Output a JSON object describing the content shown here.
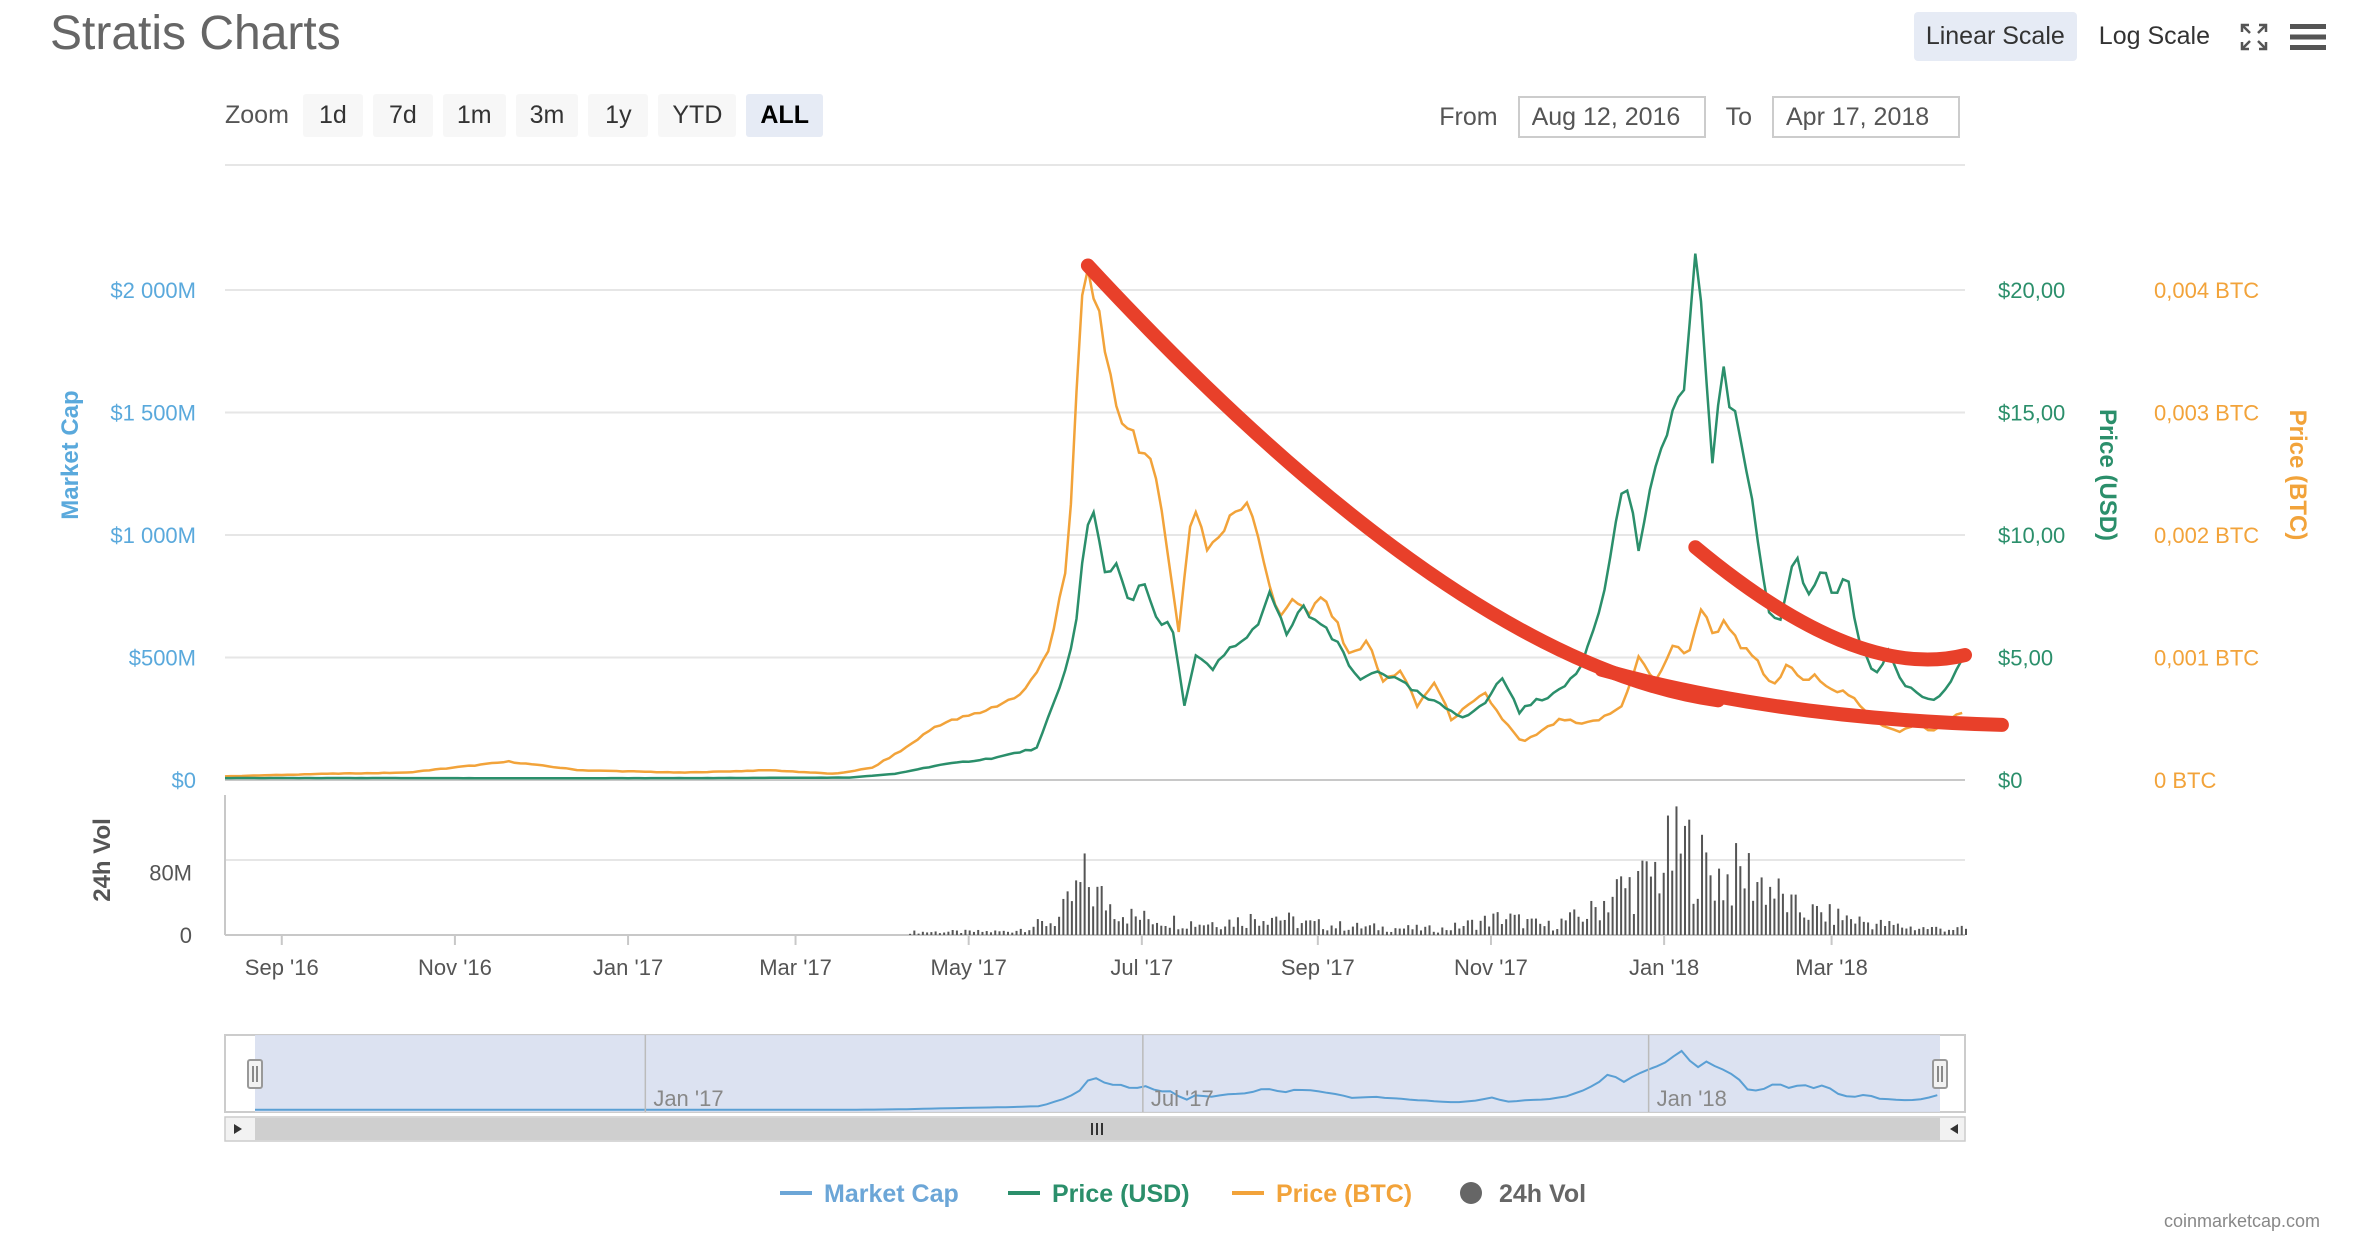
{
  "title": "Stratis Charts",
  "scale": {
    "linear": "Linear Scale",
    "log": "Log Scale",
    "active": "linear"
  },
  "zoom": {
    "label": "Zoom",
    "buttons": [
      "1d",
      "7d",
      "1m",
      "3m",
      "1y",
      "YTD",
      "ALL"
    ],
    "active": "ALL"
  },
  "range": {
    "from_label": "From",
    "from": "Aug 12, 2016",
    "to_label": "To",
    "to": "Apr 17, 2018"
  },
  "legend": [
    {
      "name": "Market Cap",
      "color": "#6ca6d7",
      "shape": "line"
    },
    {
      "name": "Price (USD)",
      "color": "#2b8f6b",
      "shape": "line"
    },
    {
      "name": "Price (BTC)",
      "color": "#f2a33a",
      "shape": "line"
    },
    {
      "name": "24h Vol",
      "color": "#666666",
      "shape": "circle"
    }
  ],
  "credit": "coinmarketcap.com",
  "colors": {
    "marketcap": "#5a9fd4",
    "usd": "#2b8f6b",
    "btc": "#f2a33a",
    "volume": "#555555",
    "annotation": "#e8402a"
  },
  "chart_data": {
    "type": "line",
    "x_start": "2016-08-12",
    "x_end": "2018-04-17",
    "x_ticks": [
      {
        "label": "Sep '16",
        "date": "2016-09-01"
      },
      {
        "label": "Nov '16",
        "date": "2016-11-01"
      },
      {
        "label": "Jan '17",
        "date": "2017-01-01"
      },
      {
        "label": "Mar '17",
        "date": "2017-03-01"
      },
      {
        "label": "May '17",
        "date": "2017-05-01"
      },
      {
        "label": "Jul '17",
        "date": "2017-07-01"
      },
      {
        "label": "Sep '17",
        "date": "2017-09-01"
      },
      {
        "label": "Nov '17",
        "date": "2017-11-01"
      },
      {
        "label": "Jan '18",
        "date": "2018-01-01"
      },
      {
        "label": "Mar '18",
        "date": "2018-03-01"
      }
    ],
    "y_left": {
      "label": "Market Cap",
      "ticks": [
        "$0",
        "$500M",
        "$1 000M",
        "$1 500M",
        "$2 000M"
      ],
      "range": [
        0,
        2000
      ]
    },
    "y_usd": {
      "label": "Price (USD)",
      "ticks": [
        "$0",
        "$5,00",
        "$10,00",
        "$15,00",
        "$20,00"
      ],
      "range": [
        0,
        20
      ]
    },
    "y_btc": {
      "label": "Price (BTC)",
      "ticks": [
        "0 BTC",
        "0,001 BTC",
        "0,002 BTC",
        "0,003 BTC",
        "0,004 BTC"
      ],
      "range": [
        0,
        0.004
      ]
    },
    "y_volume": {
      "label": "24h Vol",
      "ticks": [
        "0",
        "80M"
      ],
      "range": [
        0,
        160
      ]
    },
    "series": [
      {
        "name": "Price (USD)",
        "points": [
          [
            "2016-08-12",
            0.08
          ],
          [
            "2016-10-01",
            0.08
          ],
          [
            "2016-12-01",
            0.07
          ],
          [
            "2017-02-01",
            0.08
          ],
          [
            "2017-03-20",
            0.1
          ],
          [
            "2017-04-05",
            0.25
          ],
          [
            "2017-04-20",
            0.6
          ],
          [
            "2017-05-10",
            0.9
          ],
          [
            "2017-05-25",
            1.3
          ],
          [
            "2017-06-03",
            4.0
          ],
          [
            "2017-06-08",
            6.5
          ],
          [
            "2017-06-11",
            10.0
          ],
          [
            "2017-06-14",
            10.8
          ],
          [
            "2017-06-18",
            8.5
          ],
          [
            "2017-06-22",
            8.8
          ],
          [
            "2017-06-27",
            7.3
          ],
          [
            "2017-07-02",
            8.0
          ],
          [
            "2017-07-06",
            6.5
          ],
          [
            "2017-07-12",
            6.2
          ],
          [
            "2017-07-16",
            3.0
          ],
          [
            "2017-07-20",
            5.0
          ],
          [
            "2017-07-26",
            4.5
          ],
          [
            "2017-08-02",
            5.5
          ],
          [
            "2017-08-08",
            5.8
          ],
          [
            "2017-08-15",
            7.5
          ],
          [
            "2017-08-21",
            6.0
          ],
          [
            "2017-08-27",
            7.0
          ],
          [
            "2017-09-03",
            6.2
          ],
          [
            "2017-09-10",
            5.2
          ],
          [
            "2017-09-15",
            4.0
          ],
          [
            "2017-09-22",
            4.5
          ],
          [
            "2017-09-30",
            4.0
          ],
          [
            "2017-10-08",
            3.4
          ],
          [
            "2017-10-15",
            3.0
          ],
          [
            "2017-10-22",
            2.6
          ],
          [
            "2017-10-29",
            3.0
          ],
          [
            "2017-11-05",
            4.2
          ],
          [
            "2017-11-11",
            2.8
          ],
          [
            "2017-11-18",
            3.3
          ],
          [
            "2017-11-25",
            3.6
          ],
          [
            "2017-12-02",
            4.5
          ],
          [
            "2017-12-08",
            6.5
          ],
          [
            "2017-12-13",
            9.0
          ],
          [
            "2017-12-18",
            12.5
          ],
          [
            "2017-12-23",
            9.5
          ],
          [
            "2017-12-28",
            12.0
          ],
          [
            "2018-01-02",
            14.5
          ],
          [
            "2018-01-08",
            16.0
          ],
          [
            "2018-01-12",
            21.0
          ],
          [
            "2018-01-15",
            18.0
          ],
          [
            "2018-01-18",
            13.0
          ],
          [
            "2018-01-21",
            17.0
          ],
          [
            "2018-01-25",
            15.0
          ],
          [
            "2018-01-29",
            13.5
          ],
          [
            "2018-02-02",
            11.0
          ],
          [
            "2018-02-06",
            7.0
          ],
          [
            "2018-02-11",
            6.5
          ],
          [
            "2018-02-16",
            9.3
          ],
          [
            "2018-02-21",
            7.5
          ],
          [
            "2018-02-26",
            8.8
          ],
          [
            "2018-03-02",
            7.5
          ],
          [
            "2018-03-06",
            8.5
          ],
          [
            "2018-03-11",
            5.5
          ],
          [
            "2018-03-16",
            4.2
          ],
          [
            "2018-03-21",
            5.2
          ],
          [
            "2018-03-26",
            3.8
          ],
          [
            "2018-03-31",
            3.6
          ],
          [
            "2018-04-05",
            3.2
          ],
          [
            "2018-04-10",
            3.6
          ],
          [
            "2018-04-17",
            5.2
          ]
        ]
      },
      {
        "name": "Price (BTC)",
        "points": [
          [
            "2016-08-12",
            3e-05
          ],
          [
            "2016-09-15",
            5e-05
          ],
          [
            "2016-10-15",
            6e-05
          ],
          [
            "2016-11-20",
            0.00015
          ],
          [
            "2016-12-15",
            8e-05
          ],
          [
            "2017-01-20",
            6e-05
          ],
          [
            "2017-02-20",
            8e-05
          ],
          [
            "2017-03-15",
            5e-05
          ],
          [
            "2017-03-28",
            0.0001
          ],
          [
            "2017-04-08",
            0.00025
          ],
          [
            "2017-04-20",
            0.00045
          ],
          [
            "2017-05-05",
            0.00055
          ],
          [
            "2017-05-20",
            0.0007
          ],
          [
            "2017-05-30",
            0.0011
          ],
          [
            "2017-06-05",
            0.0018
          ],
          [
            "2017-06-10",
            0.004
          ],
          [
            "2017-06-13",
            0.0042
          ],
          [
            "2017-06-18",
            0.0034
          ],
          [
            "2017-06-23",
            0.003
          ],
          [
            "2017-06-29",
            0.0028
          ],
          [
            "2017-07-05",
            0.0025
          ],
          [
            "2017-07-09",
            0.0021
          ],
          [
            "2017-07-14",
            0.0012
          ],
          [
            "2017-07-19",
            0.0023
          ],
          [
            "2017-07-24",
            0.0019
          ],
          [
            "2017-07-29",
            0.002
          ],
          [
            "2017-08-03",
            0.0022
          ],
          [
            "2017-08-08",
            0.0023
          ],
          [
            "2017-08-13",
            0.0018
          ],
          [
            "2017-08-18",
            0.0013
          ],
          [
            "2017-08-23",
            0.0015
          ],
          [
            "2017-08-29",
            0.00135
          ],
          [
            "2017-09-03",
            0.0015
          ],
          [
            "2017-09-08",
            0.00125
          ],
          [
            "2017-09-13",
            0.001
          ],
          [
            "2017-09-18",
            0.00115
          ],
          [
            "2017-09-24",
            0.0008
          ],
          [
            "2017-09-30",
            0.0009
          ],
          [
            "2017-10-06",
            0.0006
          ],
          [
            "2017-10-12",
            0.0008
          ],
          [
            "2017-10-18",
            0.0005
          ],
          [
            "2017-10-24",
            0.0006
          ],
          [
            "2017-10-30",
            0.0007
          ],
          [
            "2017-11-05",
            0.0005
          ],
          [
            "2017-11-12",
            0.0003
          ],
          [
            "2017-11-19",
            0.0004
          ],
          [
            "2017-11-26",
            0.0005
          ],
          [
            "2017-12-03",
            0.00045
          ],
          [
            "2017-12-10",
            0.0005
          ],
          [
            "2017-12-17",
            0.0006
          ],
          [
            "2017-12-23",
            0.001
          ],
          [
            "2017-12-29",
            0.0008
          ],
          [
            "2018-01-04",
            0.0011
          ],
          [
            "2018-01-09",
            0.001
          ],
          [
            "2018-01-14",
            0.0014
          ],
          [
            "2018-01-18",
            0.0012
          ],
          [
            "2018-01-23",
            0.0013
          ],
          [
            "2018-01-28",
            0.0011
          ],
          [
            "2018-02-03",
            0.00095
          ],
          [
            "2018-02-08",
            0.00075
          ],
          [
            "2018-02-14",
            0.00095
          ],
          [
            "2018-02-19",
            0.0008
          ],
          [
            "2018-02-24",
            0.00085
          ],
          [
            "2018-03-01",
            0.00075
          ],
          [
            "2018-03-07",
            0.0007
          ],
          [
            "2018-03-13",
            0.00055
          ],
          [
            "2018-03-19",
            0.00045
          ],
          [
            "2018-03-25",
            0.0004
          ],
          [
            "2018-03-31",
            0.00045
          ],
          [
            "2018-04-06",
            0.0004
          ],
          [
            "2018-04-12",
            0.0005
          ],
          [
            "2018-04-17",
            0.00058
          ]
        ]
      },
      {
        "name": "24h Vol",
        "points": [
          [
            "2017-04-10",
            5
          ],
          [
            "2017-05-15",
            6
          ],
          [
            "2017-06-01",
            25
          ],
          [
            "2017-06-11",
            95
          ],
          [
            "2017-06-14",
            70
          ],
          [
            "2017-06-20",
            50
          ],
          [
            "2017-06-28",
            30
          ],
          [
            "2017-07-10",
            25
          ],
          [
            "2017-07-20",
            20
          ],
          [
            "2017-08-05",
            25
          ],
          [
            "2017-08-15",
            35
          ],
          [
            "2017-08-25",
            20
          ],
          [
            "2017-09-10",
            15
          ],
          [
            "2017-09-25",
            12
          ],
          [
            "2017-10-15",
            10
          ],
          [
            "2017-11-05",
            30
          ],
          [
            "2017-11-20",
            15
          ],
          [
            "2017-12-05",
            35
          ],
          [
            "2017-12-15",
            75
          ],
          [
            "2017-12-25",
            90
          ],
          [
            "2018-01-02",
            130
          ],
          [
            "2018-01-08",
            150
          ],
          [
            "2018-01-14",
            115
          ],
          [
            "2018-01-22",
            95
          ],
          [
            "2018-01-30",
            105
          ],
          [
            "2018-02-07",
            80
          ],
          [
            "2018-02-15",
            45
          ],
          [
            "2018-02-25",
            35
          ],
          [
            "2018-03-05",
            30
          ],
          [
            "2018-03-15",
            20
          ],
          [
            "2018-03-30",
            12
          ],
          [
            "2018-04-17",
            10
          ]
        ]
      }
    ],
    "navigator": {
      "ticks": [
        "Jan '17",
        "Jul '17",
        "Jan '18"
      ]
    },
    "annotations": [
      {
        "type": "curve",
        "from": [
          "2017-06-12",
          0.0042
        ],
        "via": [
          "2017-10-20",
          0.00095
        ],
        "to": [
          "2018-01-20",
          0.00065
        ]
      },
      {
        "type": "curve",
        "from": [
          "2018-01-12",
          0.0019
        ],
        "via": [
          "2018-03-10",
          0.0008
        ],
        "to": [
          "2018-04-17",
          0.00102
        ]
      },
      {
        "type": "curve",
        "from": [
          "2017-12-10",
          0.0009
        ],
        "via": [
          "2018-02-10",
          0.0005
        ],
        "to": [
          "2018-04-30",
          0.00045
        ]
      }
    ]
  }
}
